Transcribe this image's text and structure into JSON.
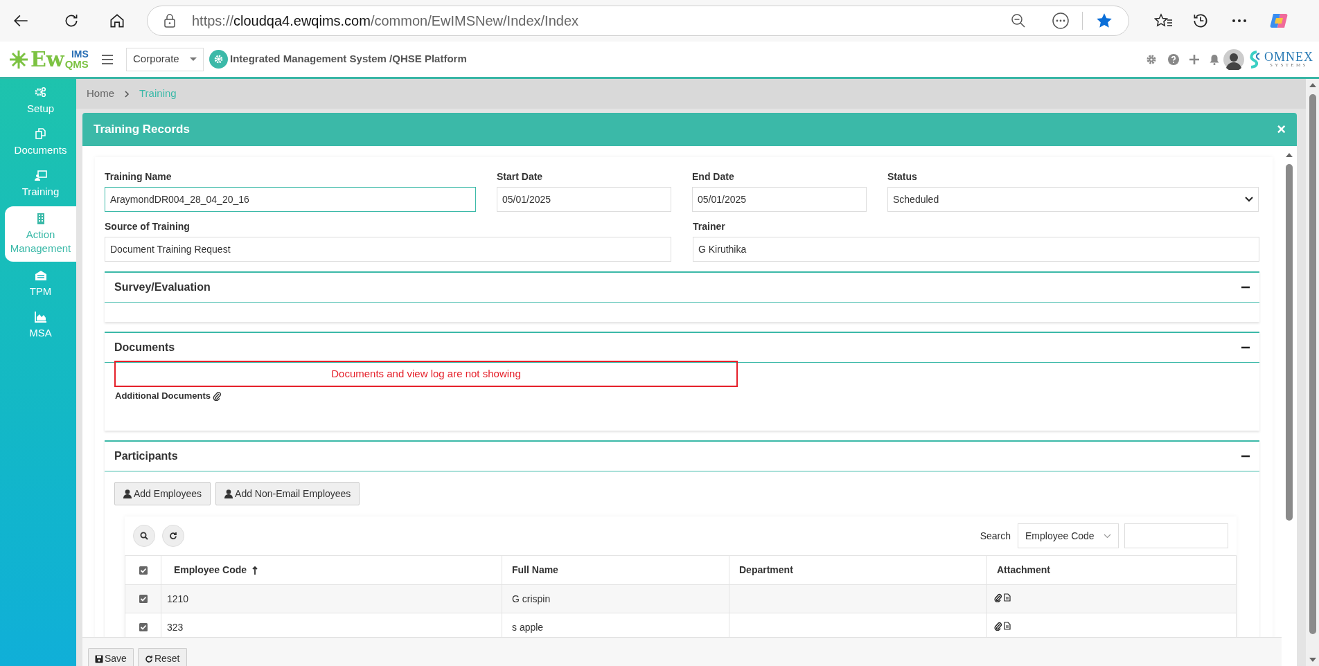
{
  "browser": {
    "url_scheme": "https://",
    "url_host": "cloudqa4.ewqims.com",
    "url_path": "/common/EwIMSNew/Index/Index",
    "favorited": true
  },
  "app_header": {
    "logo": {
      "main": "Ew",
      "top": "IMS",
      "bottom": "QMS"
    },
    "company_select": "Corporate",
    "platform_title": "Integrated Management System /QHSE Platform",
    "vendor_logo": {
      "name": "OMNEX",
      "tagline": "SYSTEMS"
    }
  },
  "sidebar": {
    "items": [
      {
        "label": "Setup",
        "selected": false
      },
      {
        "label": "Documents",
        "selected": false
      },
      {
        "label": "Training",
        "selected": false
      },
      {
        "label": "Action Management",
        "selected": true
      },
      {
        "label": "TPM",
        "selected": false
      },
      {
        "label": "MSA",
        "selected": false
      }
    ]
  },
  "breadcrumb": [
    "Home",
    "Training"
  ],
  "panel": {
    "title": "Training Records",
    "close": "×"
  },
  "fields": [
    {
      "label": "Training Name",
      "value": "AraymondDR004_28_04_20_16",
      "kind": "text",
      "focused": true
    },
    {
      "label": "Start Date",
      "value": "05/01/2025",
      "kind": "text",
      "focused": false
    },
    {
      "label": "End Date",
      "value": "05/01/2025",
      "kind": "text",
      "focused": false
    },
    {
      "label": "Status",
      "value": "Scheduled",
      "kind": "select",
      "focused": false
    },
    {
      "label": "Source of Training",
      "value": "Document Training Request",
      "kind": "text",
      "focused": false
    },
    {
      "label": "Trainer",
      "value": "G Kiruthika",
      "kind": "text",
      "focused": false
    }
  ],
  "sections": [
    {
      "title": "Survey/Evaluation",
      "expanded": true
    },
    {
      "title": "Documents",
      "expanded": true
    },
    {
      "title": "Participants",
      "expanded": true
    }
  ],
  "documents": {
    "additional_label": "Additional Documents",
    "annotation": "Documents and view log are not showing"
  },
  "participants": {
    "buttons": [
      "Add Employees",
      "Add Non-Email Employees"
    ],
    "search_label": "Search",
    "search_by": "Employee Code"
  },
  "table": {
    "select_all_checked": true,
    "columns": [
      {
        "label": "Employee Code",
        "sorted": true
      },
      {
        "label": "Full Name",
        "sorted": false
      },
      {
        "label": "Department",
        "sorted": false
      },
      {
        "label": "Attachment",
        "sorted": false
      }
    ],
    "rows": [
      {
        "checked": true,
        "employee_code": "1210",
        "full_name": "G crispin"
      },
      {
        "checked": true,
        "employee_code": "323",
        "full_name": "s apple"
      }
    ]
  },
  "footer_buttons": [
    "Save",
    "Reset"
  ]
}
